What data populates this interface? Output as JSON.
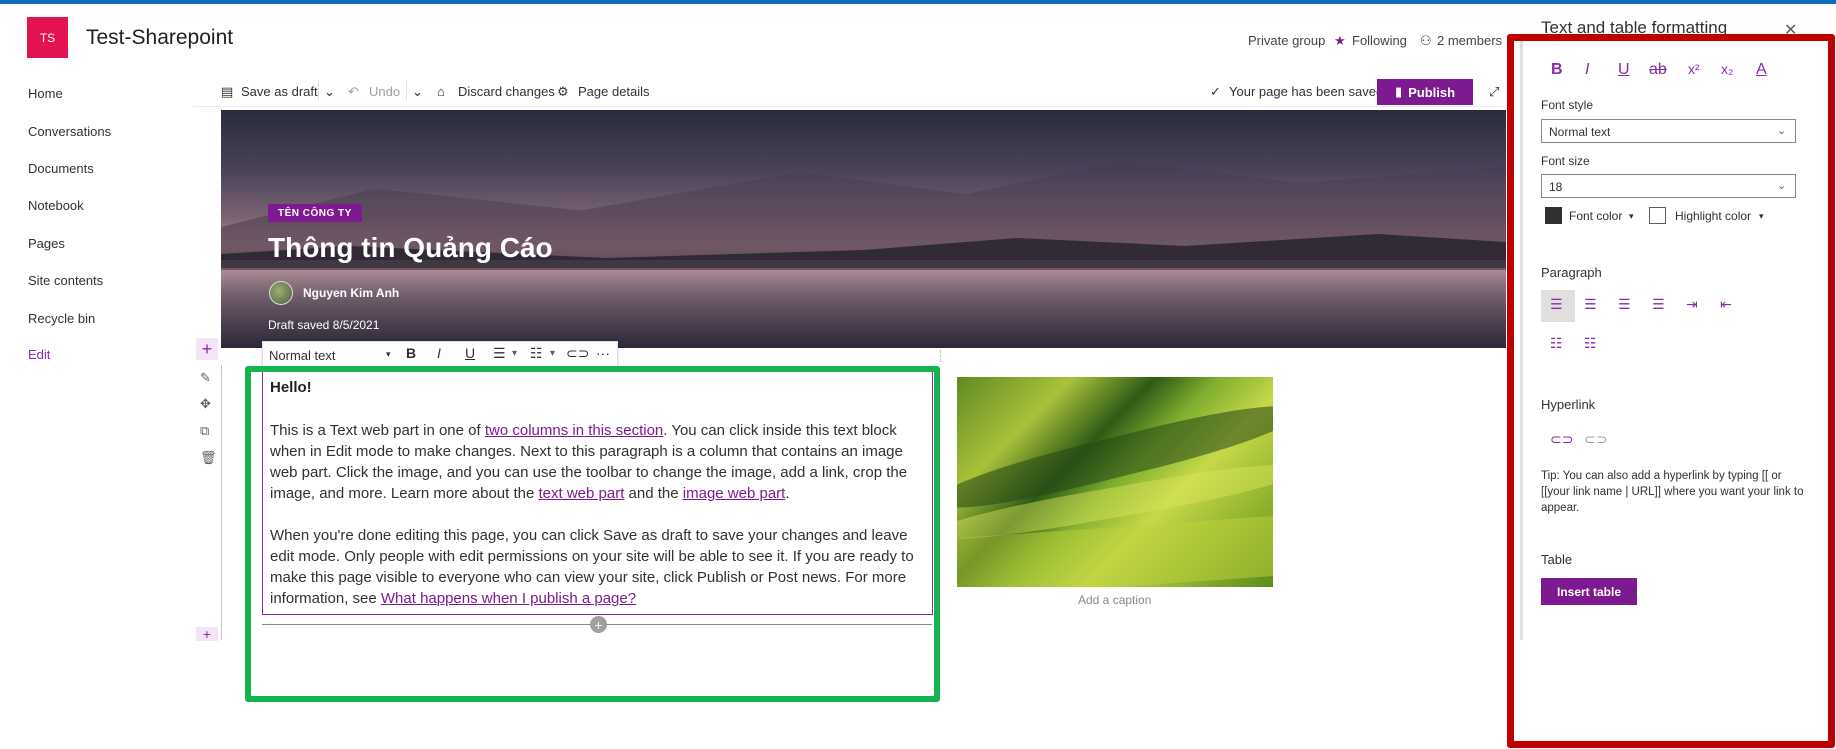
{
  "header": {
    "logo_initials": "TS",
    "site_title": "Test-Sharepoint",
    "private_group": "Private group",
    "following": "Following",
    "members": "2 members",
    "star_icon": "star-icon",
    "person_icon": "person-icon"
  },
  "nav": {
    "items": [
      "Home",
      "Conversations",
      "Documents",
      "Notebook",
      "Pages",
      "Site contents",
      "Recycle bin"
    ],
    "edit": "Edit"
  },
  "commandbar": {
    "save_as_draft": "Save as draft",
    "undo": "Undo",
    "discard_changes": "Discard changes",
    "page_details": "Page details",
    "saved_status": "Your page has been saved",
    "publish": "Publish"
  },
  "hero": {
    "tag": "TÊN CÔNG TY",
    "title": "Thông tin Quảng Cáo",
    "author": "Nguyen Kim Anh",
    "draft_saved": "Draft saved 8/5/2021"
  },
  "text_toolbar": {
    "style": "Normal text",
    "bold": "B",
    "italic": "I",
    "underline": "U",
    "more": "···"
  },
  "textpart": {
    "hello": "Hello!",
    "p1_a": "This is a Text web part in one of ",
    "p1_link1": "two columns in this section",
    "p1_b": ". You can click inside this text block when in Edit mode to make changes. Next to this paragraph is a column that contains an image web part. Click the image, and you can use the toolbar to change the image, add a link, crop the image, and more. Learn more about the ",
    "p1_link2": "text web part",
    "p1_c": " and the ",
    "p1_link3": "image web part",
    "p1_d": ".",
    "p2_a": "When you're done editing this page, you can click Save as draft to save your changes and leave edit mode. Only people with edit permissions on your site will be able to see it. If you are ready to make this page visible to everyone who can view your site, click Publish or Post news. For more information, see ",
    "p2_link": "What happens when I publish a page? "
  },
  "image": {
    "caption": "Add a caption"
  },
  "pane": {
    "title": "Text and table formatting",
    "close": "✕",
    "fmt_bold": "B",
    "fmt_italic": "I",
    "fmt_underline": "U",
    "fmt_strike": "ab",
    "fmt_super": "x²",
    "fmt_sub": "x₂",
    "fmt_clear": "A",
    "font_style_label": "Font style",
    "font_style_value": "Normal text",
    "font_size_label": "Font size",
    "font_size_value": "18",
    "font_color": "Font color",
    "highlight_color": "Highlight color",
    "paragraph": "Paragraph",
    "hyperlink": "Hyperlink",
    "tip": "Tip: You can also add a hyperlink by typing [[ or [[your link name | URL]] where you want your link to appear.",
    "table": "Table",
    "insert_table": "Insert table"
  },
  "colors": {
    "accent": "#7e1a8f",
    "logo": "#e3134f",
    "green_highlight": "#16b44e",
    "red_highlight": "#c00000"
  }
}
